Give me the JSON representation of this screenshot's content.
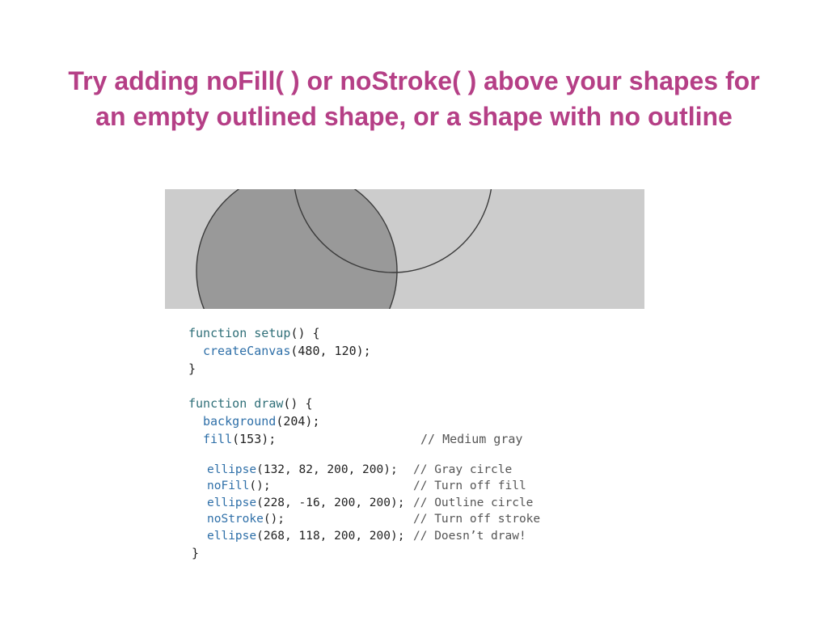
{
  "slide": {
    "title_line_1": "Try adding noFill( ) or noStroke( ) above your shapes for",
    "title_line_2": "an empty outlined shape, or a shape with no outline"
  },
  "colors": {
    "title": "#b53f86",
    "canvas_background": "#cccccc",
    "circle_fill": "#999999",
    "stroke": "#3a3a3a",
    "keyword": "#2f6f78",
    "function": "#2e6fa8",
    "comment": "#555555"
  },
  "code": {
    "setup_keyword": "function",
    "setup_name": "setup",
    "setup_open": "() {",
    "create_canvas_fn": "createCanvas",
    "create_canvas_args": "(480, 120);",
    "setup_close": "}",
    "draw_keyword": "function",
    "draw_name": "draw",
    "draw_open": "() {",
    "background_fn": "background",
    "background_args": "(204);",
    "fill_fn": "fill",
    "fill_args": "(153);",
    "fill_comment": "// Medium gray",
    "ellipse1_fn": "ellipse",
    "ellipse1_args": "(132, 82, 200, 200);",
    "ellipse1_comment": "// Gray circle",
    "nofill_fn": "noFill",
    "nofill_args": "();",
    "nofill_comment": "// Turn off fill",
    "ellipse2_fn": "ellipse",
    "ellipse2_args": "(228, -16, 200, 200);",
    "ellipse2_comment": "// Outline circle",
    "nostroke_fn": "noStroke",
    "nostroke_args": "();",
    "nostroke_comment": "// Turn off stroke",
    "ellipse3_fn": "ellipse",
    "ellipse3_args": "(268, 118, 200, 200);",
    "ellipse3_comment": "// Doesn’t draw!",
    "draw_close": "}"
  }
}
